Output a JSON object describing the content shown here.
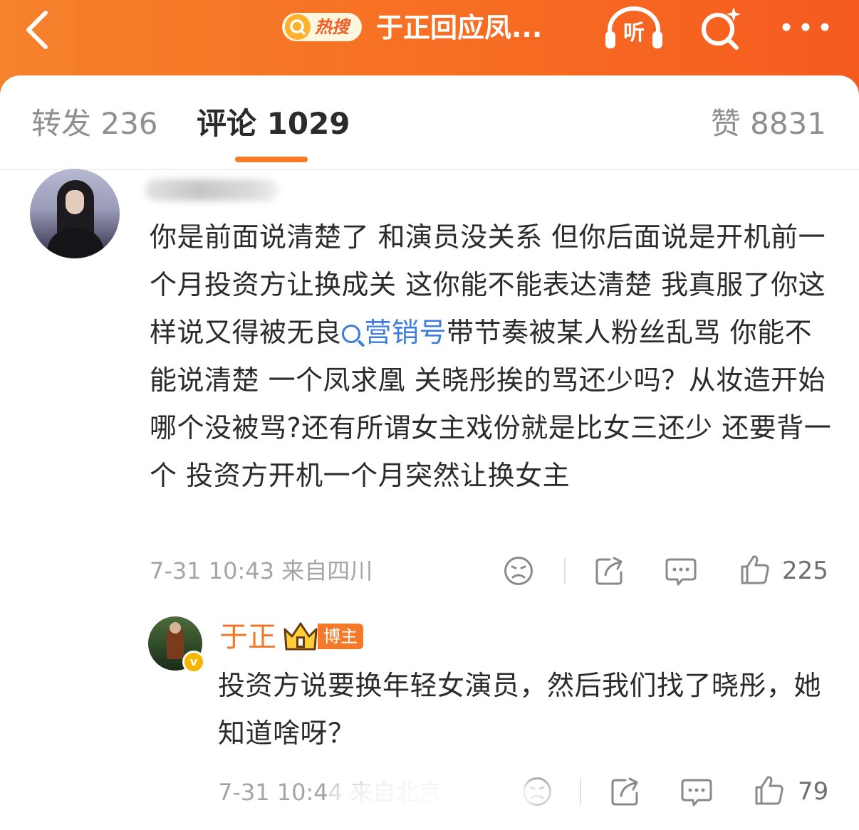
{
  "header": {
    "hot_badge_label": "热搜",
    "topic_title": "于正回应凤...",
    "listen_label": "听"
  },
  "tabs": [
    {
      "label": "转发 236"
    },
    {
      "label": "评论 1029"
    },
    {
      "label": "赞 8831"
    }
  ],
  "comment": {
    "text_before_link": "你是前面说清楚了 和演员没关系 但你后面说是开机前一个月投资方让换成关 这你能不能表达清楚 我真服了你这样说又得被无良",
    "topic_link": "营销号",
    "text_after_link": "带节奏被某人粉丝乱骂 你能不能说清楚 一个凤求凰 关晓彤挨的骂还少吗？从妆造开始 哪个没被骂?还有所谓女主戏份就是比女三还少 还要背一个 投资方开机一个月突然让换女主",
    "meta": "7-31 10:43 来自四川",
    "like_count": "225"
  },
  "reply": {
    "name": "于正",
    "author_badge": "博主",
    "verified_mark": "v",
    "text": "投资方说要换年轻女演员，然后我们找了晓彤，她知道啥呀？",
    "meta": "7-31 10:44 来自北京",
    "like_count": "79"
  },
  "colors": {
    "header_orange": "#f76d23",
    "accent": "#f77a24",
    "link_blue": "#3c7ddb",
    "name_orange": "#f0782a"
  }
}
